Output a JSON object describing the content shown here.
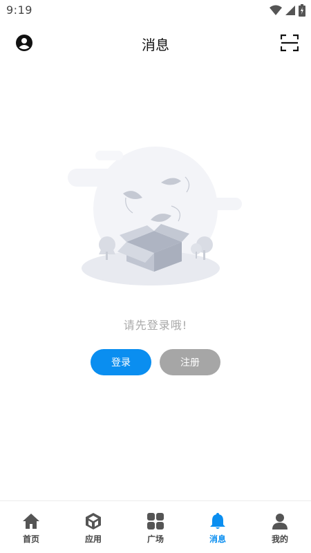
{
  "status_bar": {
    "time": "9:19"
  },
  "header": {
    "title": "消息"
  },
  "empty_state": {
    "message": "请先登录哦!"
  },
  "actions": {
    "login_label": "登录",
    "register_label": "注册"
  },
  "tabbar": {
    "items": [
      {
        "label": "首页",
        "icon": "home-icon",
        "active": false
      },
      {
        "label": "应用",
        "icon": "cube-icon",
        "active": false
      },
      {
        "label": "广场",
        "icon": "grid-icon",
        "active": false
      },
      {
        "label": "消息",
        "icon": "bell-icon",
        "active": true
      },
      {
        "label": "我的",
        "icon": "user-icon",
        "active": false
      }
    ]
  },
  "colors": {
    "accent": "#0a8ef0",
    "secondary_button": "#a6a6a6",
    "tab_inactive": "#555555"
  }
}
